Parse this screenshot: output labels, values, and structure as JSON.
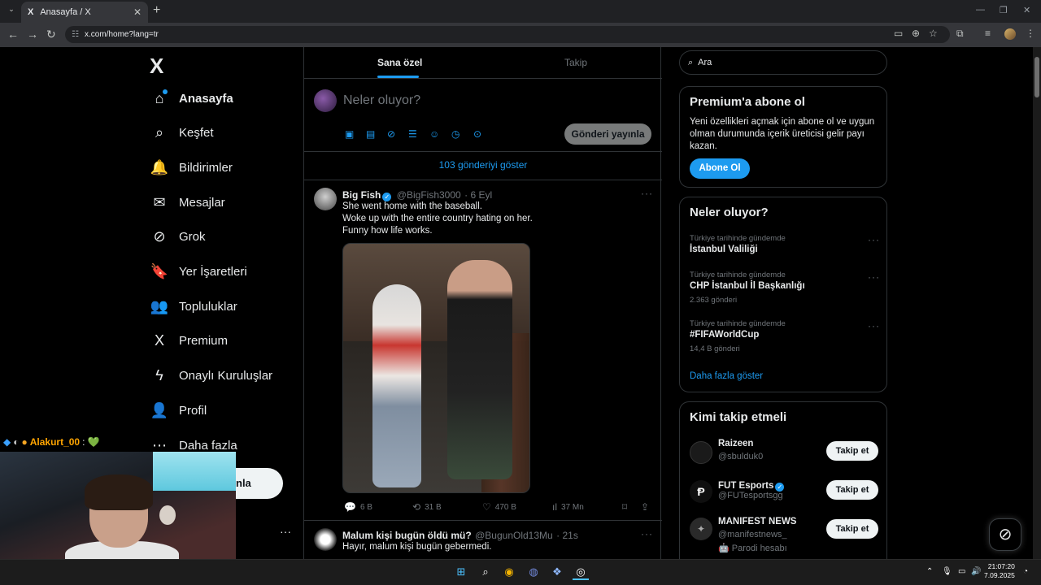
{
  "browser": {
    "tab_title": "Anasayfa / X",
    "tab_logo": "X",
    "url": "x.com/home?lang=tr"
  },
  "sidebar": {
    "logo": "X",
    "items": [
      {
        "label": "Anasayfa",
        "icon": "home-icon",
        "glyph": "⌂"
      },
      {
        "label": "Keşfet",
        "icon": "search-icon",
        "glyph": "⌕"
      },
      {
        "label": "Bildirimler",
        "icon": "bell-icon",
        "glyph": "🔔"
      },
      {
        "label": "Mesajlar",
        "icon": "mail-icon",
        "glyph": "✉"
      },
      {
        "label": "Grok",
        "icon": "grok-icon",
        "glyph": "⊘"
      },
      {
        "label": "Yer İşaretleri",
        "icon": "bookmark-icon",
        "glyph": "🔖"
      },
      {
        "label": "Topluluklar",
        "icon": "communities-icon",
        "glyph": "👥"
      },
      {
        "label": "Premium",
        "icon": "x-premium-icon",
        "glyph": "X"
      },
      {
        "label": "Onaylı Kuruluşlar",
        "icon": "lightning-icon",
        "glyph": "ϟ"
      },
      {
        "label": "Profil",
        "icon": "person-icon",
        "glyph": "👤"
      },
      {
        "label": "Daha fazla",
        "icon": "more-circle-icon",
        "glyph": "⋯"
      }
    ],
    "post_button_partial": "nla",
    "more_dots": "···"
  },
  "chat_overlay": {
    "username": "Alakurt_00",
    "separator": ":",
    "emoji": "💚"
  },
  "timeline": {
    "tabs": [
      "Sana özel",
      "Takip"
    ],
    "composer_placeholder": "Neler oluyor?",
    "post_button": "Gönderi yayınla",
    "show_posts": "103 gönderiyi göster",
    "tweets": [
      {
        "name": "Big Fish",
        "handle": "@BigFish3000",
        "time": "· 6 Eyl",
        "lines": [
          "She went home with the baseball.",
          "Woke up with the entire country hating on her.",
          "Funny how life works."
        ],
        "replies": "6 B",
        "retweets": "31 B",
        "likes": "470 B",
        "views": "37 Mn"
      },
      {
        "name": "Malum kişi bugün öldü mü?",
        "handle": "@BugunOld13Mu",
        "time": "· 21s",
        "lines": [
          "Hayır, malum kişi bugün gebermedi."
        ]
      }
    ]
  },
  "right": {
    "search_placeholder": "Ara",
    "premium": {
      "title": "Premium'a abone ol",
      "text": "Yeni özellikleri açmak için abone ol ve uygun olman durumunda içerik üreticisi gelir payı kazan.",
      "button": "Abone Ol"
    },
    "trends": {
      "title": "Neler oluyor?",
      "items": [
        {
          "context": "Türkiye tarihinde gündemde",
          "name": "İstanbul Valiliği",
          "count": ""
        },
        {
          "context": "Türkiye tarihinde gündemde",
          "name": "CHP İstanbul İl Başkanlığı",
          "count": "2.363 gönderi"
        },
        {
          "context": "Türkiye tarihinde gündemde",
          "name": "#FIFAWorldCup",
          "count": "14,4 B gönderi"
        }
      ],
      "show_more": "Daha fazla göster"
    },
    "who_to_follow": {
      "title": "Kimi takip etmeli",
      "accounts": [
        {
          "name": "Raizeen",
          "handle": "@sbulduk0",
          "extra": "",
          "button": "Takip et"
        },
        {
          "name": "FUT Esports",
          "handle": "@FUTesportsgg",
          "extra": "",
          "button": "Takip et"
        },
        {
          "name": "MANIFEST NEWS",
          "handle": "@manifestnews_",
          "extra": "🤖 Parodi hesabı",
          "button": "Takip et"
        }
      ]
    }
  },
  "taskbar": {
    "time": "21:07:20",
    "date": "7.09.2025"
  }
}
